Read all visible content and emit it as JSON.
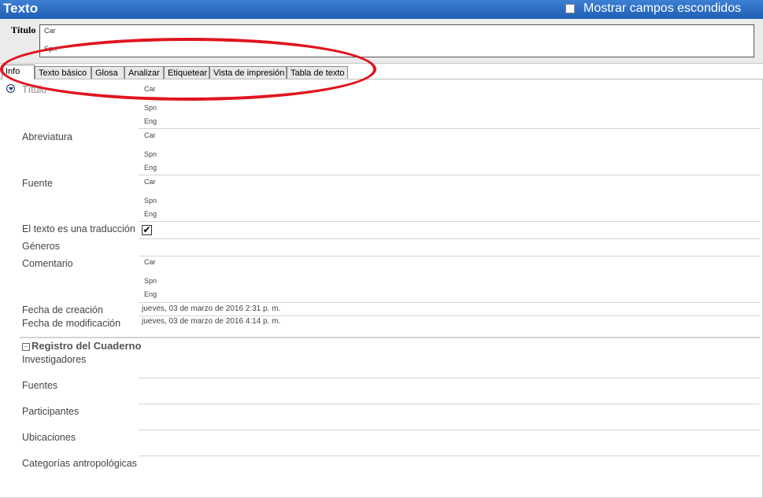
{
  "header": {
    "title": "Texto",
    "show_hidden": "Mostrar campos escondidos"
  },
  "title_field": {
    "label": "Título",
    "values": [
      "Car",
      "Spn"
    ]
  },
  "tabs": [
    "Info",
    "Texto básico",
    "Glosa",
    "Analizar",
    "Etiquetear",
    "Vista de impresión",
    "Tabla de texto"
  ],
  "info": {
    "titulo_label": "Título",
    "titulo_ws": [
      "Car",
      "Spn",
      "Eng"
    ],
    "abreviatura_label": "Abreviatura",
    "abreviatura_ws": [
      "Car",
      "Spn",
      "Eng"
    ],
    "fuente_label": "Fuente",
    "fuente_ws": [
      "Car",
      "Spn",
      "Eng"
    ],
    "traduccion_label": "El texto es una traducción",
    "traduccion_checked": true,
    "generos_label": "Géneros",
    "comentario_label": "Comentario",
    "comentario_ws": [
      "Car",
      "Spn",
      "Eng"
    ],
    "creacion_label": "Fecha de creación",
    "creacion_value": "jueves, 03 de marzo de 2016 2:31 p. m.",
    "modificacion_label": "Fecha de modificación",
    "modificacion_value": "jueves, 03 de marzo de 2016 4:14 p. m."
  },
  "notebook": {
    "section_title": "Registro del Cuaderno",
    "collapse_symbol": "−",
    "investigadores": "Investigadores",
    "fuentes": "Fuentes",
    "participantes": "Participantes",
    "ubicaciones": "Ubicaciones",
    "categorias": "Categorías antropológicas"
  },
  "colors": {
    "header": "#2a6bc2",
    "annotation": "#e0141e"
  }
}
